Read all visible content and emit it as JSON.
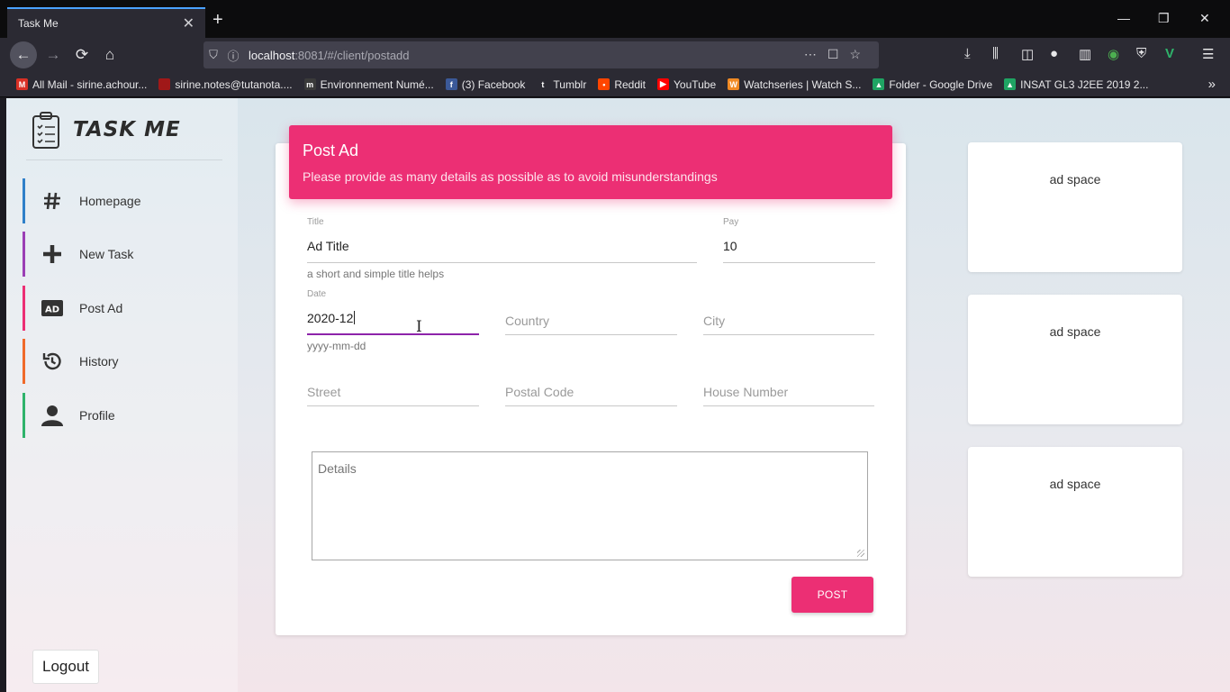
{
  "browser": {
    "tab_title": "Task Me",
    "tab_close": "✕",
    "new_tab": "+",
    "url_host": "localhost",
    "url_rest": ":8081/#/client/postadd",
    "bookmarks": [
      {
        "label": "All Mail - sirine.achour...",
        "icon": "gmail-icon",
        "color": "#d93025",
        "glyph": "M"
      },
      {
        "label": "sirine.notes@tutanota....",
        "icon": "tutanota-icon",
        "color": "#a01818",
        "glyph": ""
      },
      {
        "label": "Environnement Numé...",
        "icon": "environnement-icon",
        "color": "#3a3a3a",
        "glyph": "m"
      },
      {
        "label": "(3) Facebook",
        "icon": "facebook-icon",
        "color": "#3b5998",
        "glyph": "f"
      },
      {
        "label": "Tumblr",
        "icon": "tumblr-icon",
        "color": "#2b2a33",
        "glyph": "t"
      },
      {
        "label": "Reddit",
        "icon": "reddit-icon",
        "color": "#ff4500",
        "glyph": "•"
      },
      {
        "label": "YouTube",
        "icon": "youtube-icon",
        "color": "#ff0000",
        "glyph": "▶"
      },
      {
        "label": "Watchseries | Watch S...",
        "icon": "watchseries-icon",
        "color": "#f08a24",
        "glyph": "W"
      },
      {
        "label": "Folder - Google Drive",
        "icon": "google-drive-icon",
        "color": "#1fa463",
        "glyph": "▲"
      },
      {
        "label": "INSAT GL3 J2EE 2019 2...",
        "icon": "google-drive-icon",
        "color": "#1fa463",
        "glyph": "▲"
      }
    ]
  },
  "sidebar": {
    "brand": "TASK ME",
    "items": [
      {
        "label": "Homepage",
        "icon": "hash-icon",
        "color": "#2f80c9"
      },
      {
        "label": "New Task",
        "icon": "plus-icon",
        "color": "#9b3fb5"
      },
      {
        "label": "Post Ad",
        "icon": "ad-icon",
        "color": "#ec2f74"
      },
      {
        "label": "History",
        "icon": "history-icon",
        "color": "#f06a2a"
      },
      {
        "label": "Profile",
        "icon": "user-icon",
        "color": "#2fb36b"
      }
    ],
    "logout": "Logout"
  },
  "form": {
    "title": "Post Ad",
    "subtitle": "Please provide as many details as possible as to avoid misunderstandings",
    "title_field": {
      "label": "Title",
      "value": "Ad Title",
      "hint": "a short and simple title helps"
    },
    "pay_field": {
      "label": "Pay",
      "value": "10"
    },
    "date_field": {
      "label": "Date",
      "value": "2020-12",
      "hint": "yyyy-mm-dd"
    },
    "country_placeholder": "Country",
    "city_placeholder": "City",
    "street_placeholder": "Street",
    "postal_placeholder": "Postal Code",
    "house_placeholder": "House Number",
    "details_placeholder": "Details",
    "post_button": "POST"
  },
  "ads": [
    "ad space",
    "ad space",
    "ad space"
  ],
  "colors": {
    "accent": "#ec2f74",
    "focus": "#8e24aa"
  }
}
